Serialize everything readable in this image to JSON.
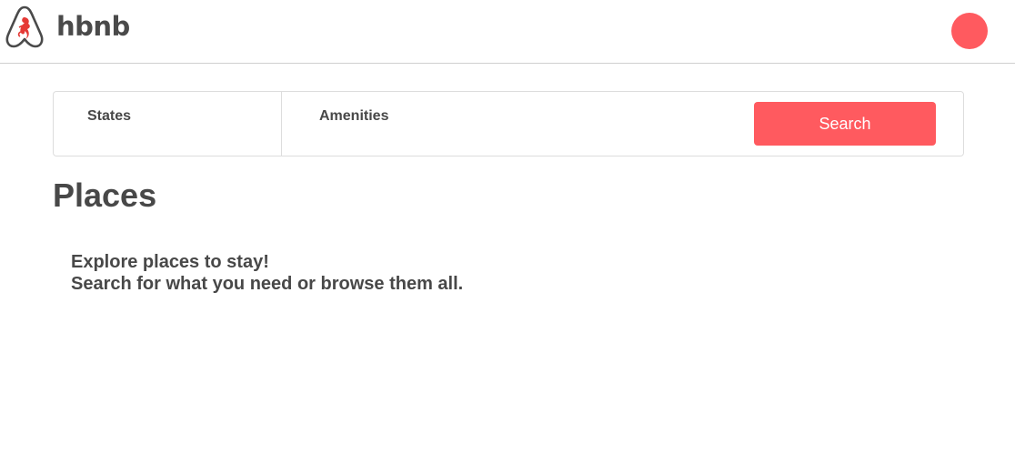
{
  "header": {
    "brand": "hbnb",
    "logo_icon": "airbnb-logo-icon",
    "avatar_icon": "user-avatar-icon"
  },
  "filters": {
    "states_label": "States",
    "amenities_label": "Amenities",
    "search_label": "Search"
  },
  "places": {
    "title": "Places",
    "intro_line1": "Explore places to stay!",
    "intro_line2": "Search for what you need or browse them all."
  },
  "colors": {
    "accent": "#ff5a5f",
    "text": "#484848",
    "border": "#dddddd",
    "header_border": "#cfcfcf"
  }
}
